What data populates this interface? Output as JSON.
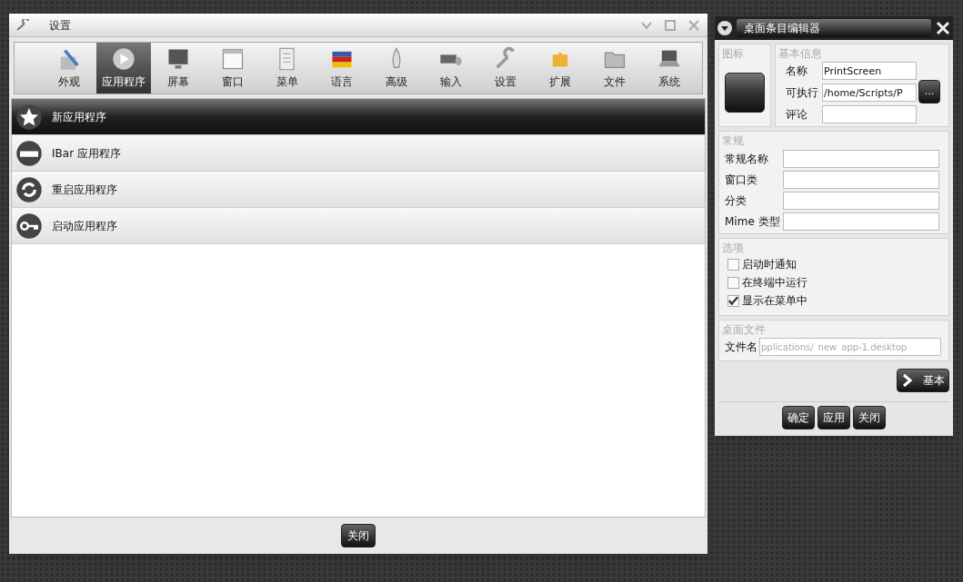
{
  "settings_window": {
    "title": "设置",
    "toolbar": [
      {
        "label": "外观",
        "selected": false
      },
      {
        "label": "应用程序",
        "selected": true
      },
      {
        "label": "屏幕",
        "selected": false
      },
      {
        "label": "窗口",
        "selected": false
      },
      {
        "label": "菜单",
        "selected": false
      },
      {
        "label": "语言",
        "selected": false
      },
      {
        "label": "高级",
        "selected": false
      },
      {
        "label": "输入",
        "selected": false
      },
      {
        "label": "设置",
        "selected": false
      },
      {
        "label": "扩展",
        "selected": false
      },
      {
        "label": "文件",
        "selected": false
      },
      {
        "label": "系统",
        "selected": false
      }
    ],
    "list": [
      {
        "label": "新应用程序",
        "kind": "star",
        "selected": true
      },
      {
        "label": "IBar 应用程序",
        "kind": "minus",
        "selected": false
      },
      {
        "label": "重启应用程序",
        "kind": "restart",
        "selected": false
      },
      {
        "label": "启动应用程序",
        "kind": "key",
        "selected": false
      }
    ],
    "close_button": "关闭"
  },
  "editor_window": {
    "title": "桌面条目编辑器",
    "icon_section": {
      "title": "图标"
    },
    "basic_info": {
      "title": "基本信息",
      "fields": [
        {
          "label": "名称",
          "value": "PrintScreen"
        },
        {
          "label": "可执行",
          "value": "/home/Scripts/P"
        },
        {
          "label": "评论"
        }
      ],
      "browse_button": "..."
    },
    "general": {
      "title": "常规",
      "fields": [
        {
          "label": "常规名称"
        },
        {
          "label": "窗口类"
        },
        {
          "label": "分类"
        },
        {
          "label": "Mime 类型"
        }
      ]
    },
    "options": {
      "title": "选项",
      "items": [
        {
          "label": "启动时通知",
          "checked": false
        },
        {
          "label": "在终端中运行",
          "checked": false
        },
        {
          "label": "显示在菜单中",
          "checked": true
        }
      ]
    },
    "desktop_file": {
      "title": "桌面文件",
      "label": "文件名",
      "value": "pplications/_new_app-1.desktop",
      "disabled": true
    },
    "basic_button": "基本",
    "buttons": [
      "确定",
      "应用",
      "关闭"
    ]
  }
}
